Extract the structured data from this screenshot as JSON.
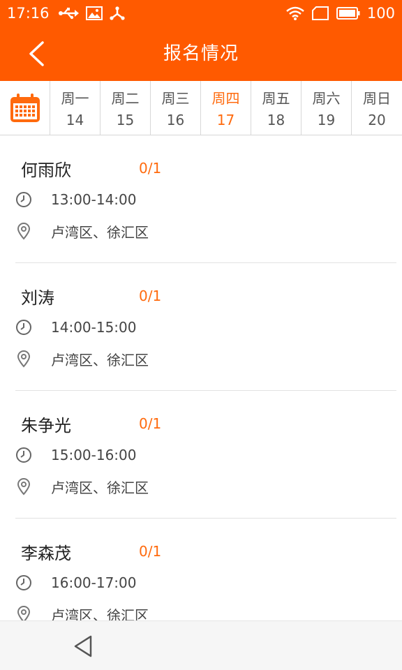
{
  "status_bar": {
    "time": "17:16",
    "battery": "100",
    "icons": [
      "usb-icon",
      "image-icon",
      "share-icon",
      "wifi-icon",
      "sim-icon",
      "battery-icon"
    ]
  },
  "header": {
    "title": "报名情况",
    "back_icon": "chevron-left-icon"
  },
  "week": {
    "calendar_icon": "calendar-icon",
    "days": [
      {
        "name": "周一",
        "date": "14"
      },
      {
        "name": "周二",
        "date": "15"
      },
      {
        "name": "周三",
        "date": "16"
      },
      {
        "name": "周四",
        "date": "17"
      },
      {
        "name": "周五",
        "date": "18"
      },
      {
        "name": "周六",
        "date": "19"
      },
      {
        "name": "周日",
        "date": "20"
      }
    ],
    "selected_index": 3
  },
  "entries": [
    {
      "name": "何雨欣",
      "count": "0/1",
      "time": "13:00-14:00",
      "location": "卢湾区、徐汇区"
    },
    {
      "name": "刘涛",
      "count": "0/1",
      "time": "14:00-15:00",
      "location": "卢湾区、徐汇区"
    },
    {
      "name": "朱争光",
      "count": "0/1",
      "time": "15:00-16:00",
      "location": "卢湾区、徐汇区"
    },
    {
      "name": "李森茂",
      "count": "0/1",
      "time": "16:00-17:00",
      "location": "卢湾区、徐汇区"
    }
  ],
  "colors": {
    "brand": "#ff5a00",
    "accent": "#ff6a0d",
    "text": "#222222",
    "secondary_text": "#444444",
    "divider": "#e2e2e2"
  }
}
